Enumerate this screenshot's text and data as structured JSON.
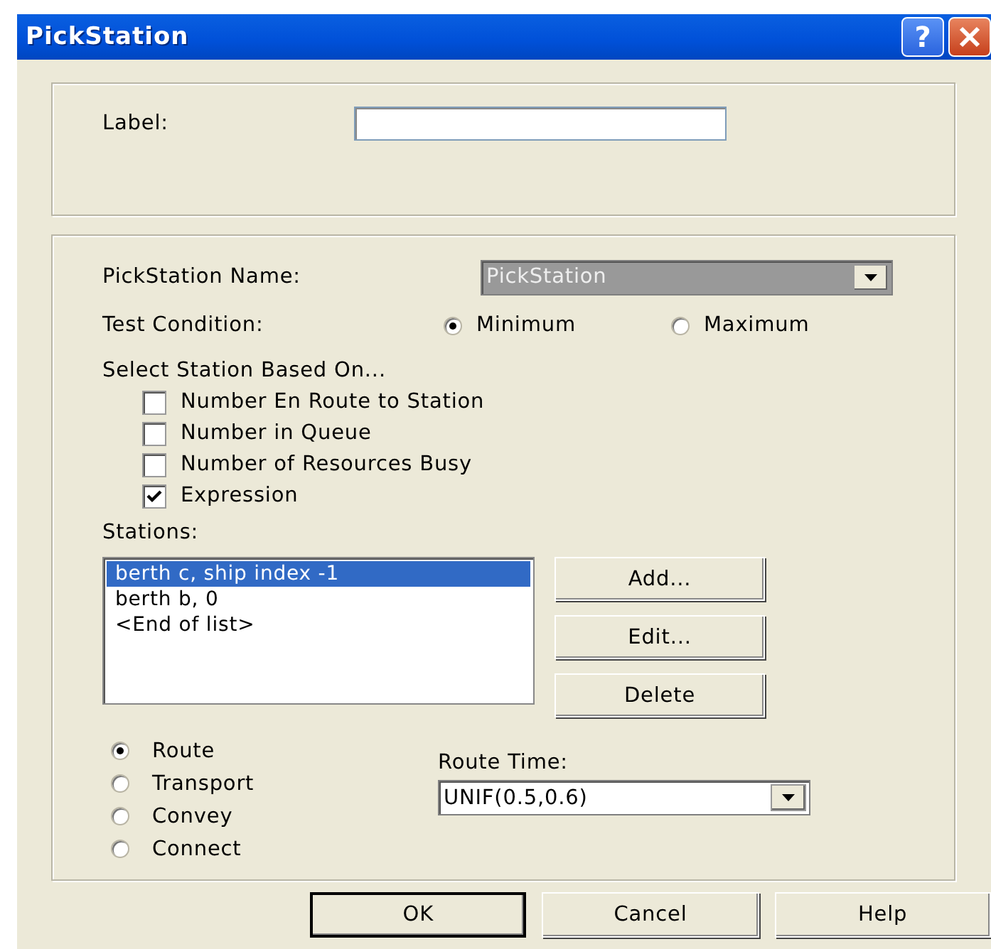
{
  "window": {
    "title": "PickStation",
    "help_button": "?"
  },
  "label_field": {
    "label": "Label:"
  },
  "pickstation_name": {
    "label": "PickStation Name:",
    "value": "PickStation",
    "disabled": true
  },
  "test_condition": {
    "label": "Test Condition:",
    "options": [
      {
        "label": "Minimum",
        "selected": true
      },
      {
        "label": "Maximum",
        "selected": false
      }
    ]
  },
  "select_based_on": {
    "label": "Select Station Based On...",
    "options": [
      {
        "label": "Number En Route to Station",
        "checked": false
      },
      {
        "label": "Number in Queue",
        "checked": false
      },
      {
        "label": "Number of Resources Busy",
        "checked": false
      },
      {
        "label": "Expression",
        "checked": true
      }
    ]
  },
  "stations": {
    "label": "Stations:",
    "items": [
      {
        "text": "berth c, ship index -1",
        "selected": true
      },
      {
        "text": "berth b, 0",
        "selected": false
      },
      {
        "text": "<End of list>",
        "selected": false
      }
    ],
    "buttons": [
      "Add...",
      "Edit...",
      "Delete"
    ]
  },
  "move_type": [
    {
      "label": "Route",
      "selected": true
    },
    {
      "label": "Transport",
      "selected": false
    },
    {
      "label": "Convey",
      "selected": false
    },
    {
      "label": "Connect",
      "selected": false
    }
  ],
  "route_time": {
    "label": "Route Time:",
    "value": "UNIF(0.5,0.6)"
  },
  "buttons": [
    {
      "label": "OK",
      "default": true
    },
    {
      "label": "Cancel",
      "default": false
    },
    {
      "label": "Help",
      "default": false
    }
  ]
}
